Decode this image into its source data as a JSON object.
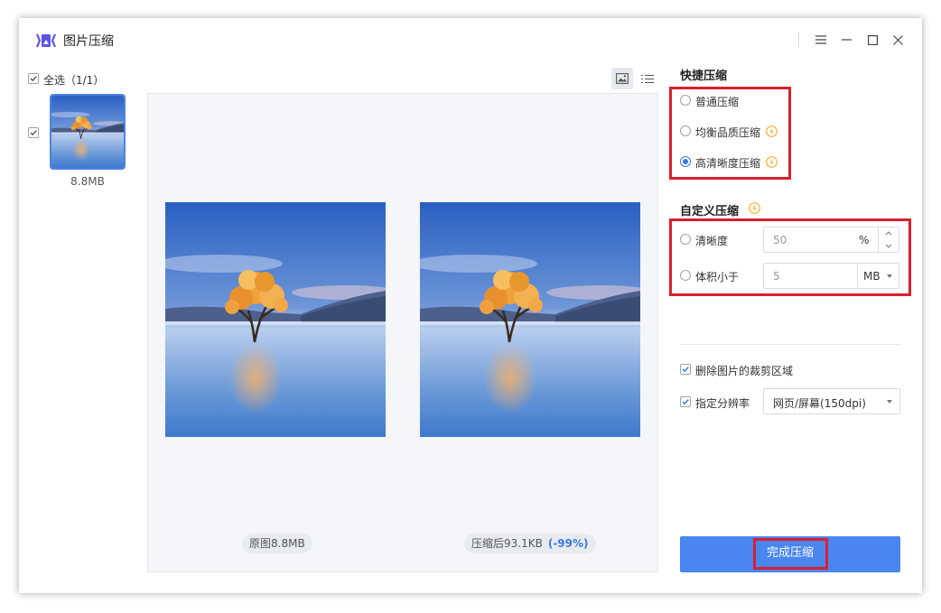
{
  "app": {
    "title": "图片压缩"
  },
  "file_list": {
    "select_all_label": "全选（1/1）",
    "items": [
      {
        "size": "8.8MB"
      }
    ]
  },
  "preview": {
    "original_label": "原图8.8MB",
    "compressed_label": "压缩后93.1KB",
    "compressed_ratio": "(-99%)"
  },
  "quick": {
    "title": "快捷压缩",
    "options": [
      {
        "label": "普通压缩"
      },
      {
        "label": "均衡品质压缩"
      },
      {
        "label": "高清晰度压缩"
      }
    ]
  },
  "custom": {
    "title": "自定义压缩",
    "clarity_label": "清晰度",
    "clarity_value": "50",
    "clarity_unit": "%",
    "size_label": "体积小于",
    "size_value": "5",
    "size_unit": "MB"
  },
  "options": {
    "remove_crop_label": "删除图片的裁剪区域",
    "resolution_label": "指定分辨率",
    "resolution_value": "网页/屏幕(150dpi)"
  },
  "finish": {
    "label": "完成压缩"
  },
  "colors": {
    "accent": "#4a86ef",
    "highlight": "#d9202f",
    "vip": "#f0b43c"
  }
}
